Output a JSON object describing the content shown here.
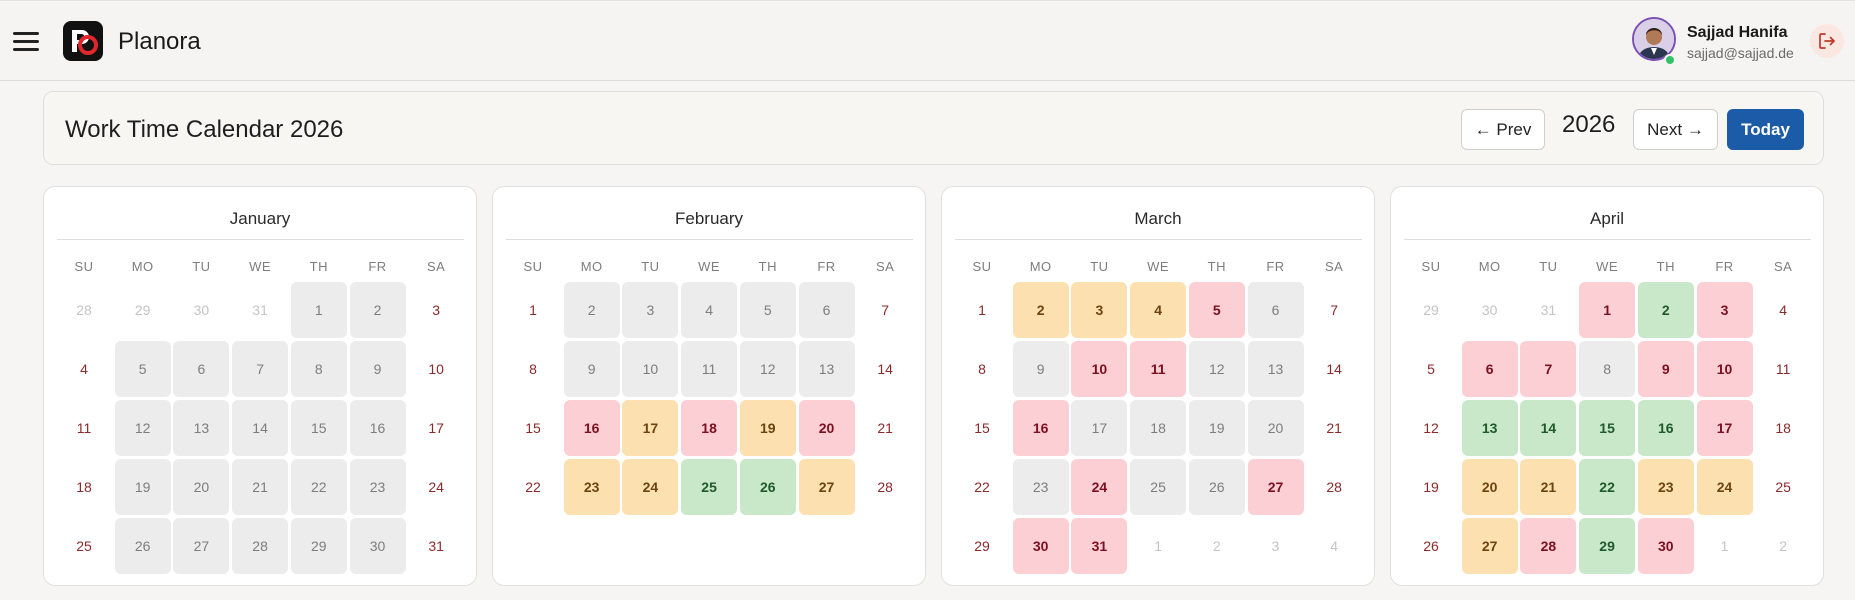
{
  "app": {
    "name": "Planora"
  },
  "user": {
    "name": "Sajjad Hanifa",
    "email": "sajjad@sajjad.de"
  },
  "icons": {
    "menu": "hamburger-icon",
    "logo": "planora-logo",
    "logout": "logout-icon",
    "avatar": "user-avatar"
  },
  "header": {
    "title": "Work Time Calendar 2026",
    "prev_label": "← Prev",
    "year": "2026",
    "next_label": "Next →",
    "today_label": "Today"
  },
  "colors": {
    "accent": "#1c5ba8",
    "gray_day": "#ececec",
    "pink_day": "#fccfd5",
    "orange_day": "#fde0b0",
    "green_day": "#c9e7c9",
    "weekend_text": "#8a2a2a",
    "online": "#34c06a"
  },
  "calendar": {
    "weekdays": [
      "SU",
      "MO",
      "TU",
      "WE",
      "TH",
      "FR",
      "SA"
    ],
    "months": [
      {
        "name": "January",
        "weeks": [
          [
            {
              "d": "28",
              "s": "out"
            },
            {
              "d": "29",
              "s": "out"
            },
            {
              "d": "30",
              "s": "out"
            },
            {
              "d": "31",
              "s": "out"
            },
            {
              "d": "1",
              "s": "gray"
            },
            {
              "d": "2",
              "s": "gray"
            },
            {
              "d": "3",
              "s": "we"
            }
          ],
          [
            {
              "d": "4",
              "s": "we"
            },
            {
              "d": "5",
              "s": "gray"
            },
            {
              "d": "6",
              "s": "gray"
            },
            {
              "d": "7",
              "s": "gray"
            },
            {
              "d": "8",
              "s": "gray"
            },
            {
              "d": "9",
              "s": "gray"
            },
            {
              "d": "10",
              "s": "we"
            }
          ],
          [
            {
              "d": "11",
              "s": "we"
            },
            {
              "d": "12",
              "s": "gray"
            },
            {
              "d": "13",
              "s": "gray"
            },
            {
              "d": "14",
              "s": "gray"
            },
            {
              "d": "15",
              "s": "gray"
            },
            {
              "d": "16",
              "s": "gray"
            },
            {
              "d": "17",
              "s": "we"
            }
          ],
          [
            {
              "d": "18",
              "s": "we"
            },
            {
              "d": "19",
              "s": "gray"
            },
            {
              "d": "20",
              "s": "gray"
            },
            {
              "d": "21",
              "s": "gray"
            },
            {
              "d": "22",
              "s": "gray"
            },
            {
              "d": "23",
              "s": "gray"
            },
            {
              "d": "24",
              "s": "we"
            }
          ],
          [
            {
              "d": "25",
              "s": "we"
            },
            {
              "d": "26",
              "s": "gray"
            },
            {
              "d": "27",
              "s": "gray"
            },
            {
              "d": "28",
              "s": "gray"
            },
            {
              "d": "29",
              "s": "gray"
            },
            {
              "d": "30",
              "s": "gray"
            },
            {
              "d": "31",
              "s": "we"
            }
          ]
        ]
      },
      {
        "name": "February",
        "weeks": [
          [
            {
              "d": "1",
              "s": "we"
            },
            {
              "d": "2",
              "s": "gray"
            },
            {
              "d": "3",
              "s": "gray"
            },
            {
              "d": "4",
              "s": "gray"
            },
            {
              "d": "5",
              "s": "gray"
            },
            {
              "d": "6",
              "s": "gray"
            },
            {
              "d": "7",
              "s": "we"
            }
          ],
          [
            {
              "d": "8",
              "s": "we"
            },
            {
              "d": "9",
              "s": "gray"
            },
            {
              "d": "10",
              "s": "gray"
            },
            {
              "d": "11",
              "s": "gray"
            },
            {
              "d": "12",
              "s": "gray"
            },
            {
              "d": "13",
              "s": "gray"
            },
            {
              "d": "14",
              "s": "we"
            }
          ],
          [
            {
              "d": "15",
              "s": "we"
            },
            {
              "d": "16",
              "s": "pink"
            },
            {
              "d": "17",
              "s": "orange"
            },
            {
              "d": "18",
              "s": "pink"
            },
            {
              "d": "19",
              "s": "orange"
            },
            {
              "d": "20",
              "s": "pink"
            },
            {
              "d": "21",
              "s": "we"
            }
          ],
          [
            {
              "d": "22",
              "s": "we"
            },
            {
              "d": "23",
              "s": "orange"
            },
            {
              "d": "24",
              "s": "orange"
            },
            {
              "d": "25",
              "s": "green"
            },
            {
              "d": "26",
              "s": "green"
            },
            {
              "d": "27",
              "s": "orange"
            },
            {
              "d": "28",
              "s": "we"
            }
          ]
        ]
      },
      {
        "name": "March",
        "weeks": [
          [
            {
              "d": "1",
              "s": "we"
            },
            {
              "d": "2",
              "s": "orange"
            },
            {
              "d": "3",
              "s": "orange"
            },
            {
              "d": "4",
              "s": "orange"
            },
            {
              "d": "5",
              "s": "pink"
            },
            {
              "d": "6",
              "s": "gray"
            },
            {
              "d": "7",
              "s": "we"
            }
          ],
          [
            {
              "d": "8",
              "s": "we"
            },
            {
              "d": "9",
              "s": "gray"
            },
            {
              "d": "10",
              "s": "pink"
            },
            {
              "d": "11",
              "s": "pink"
            },
            {
              "d": "12",
              "s": "gray"
            },
            {
              "d": "13",
              "s": "gray"
            },
            {
              "d": "14",
              "s": "we"
            }
          ],
          [
            {
              "d": "15",
              "s": "we"
            },
            {
              "d": "16",
              "s": "pink"
            },
            {
              "d": "17",
              "s": "gray"
            },
            {
              "d": "18",
              "s": "gray"
            },
            {
              "d": "19",
              "s": "gray"
            },
            {
              "d": "20",
              "s": "gray"
            },
            {
              "d": "21",
              "s": "we"
            }
          ],
          [
            {
              "d": "22",
              "s": "we"
            },
            {
              "d": "23",
              "s": "gray"
            },
            {
              "d": "24",
              "s": "pink"
            },
            {
              "d": "25",
              "s": "gray"
            },
            {
              "d": "26",
              "s": "gray"
            },
            {
              "d": "27",
              "s": "pink"
            },
            {
              "d": "28",
              "s": "we"
            }
          ],
          [
            {
              "d": "29",
              "s": "we"
            },
            {
              "d": "30",
              "s": "pink"
            },
            {
              "d": "31",
              "s": "pink"
            },
            {
              "d": "1",
              "s": "out"
            },
            {
              "d": "2",
              "s": "out"
            },
            {
              "d": "3",
              "s": "out"
            },
            {
              "d": "4",
              "s": "out"
            }
          ]
        ]
      },
      {
        "name": "April",
        "weeks": [
          [
            {
              "d": "29",
              "s": "out"
            },
            {
              "d": "30",
              "s": "out"
            },
            {
              "d": "31",
              "s": "out"
            },
            {
              "d": "1",
              "s": "pink"
            },
            {
              "d": "2",
              "s": "green"
            },
            {
              "d": "3",
              "s": "pink"
            },
            {
              "d": "4",
              "s": "we"
            }
          ],
          [
            {
              "d": "5",
              "s": "we"
            },
            {
              "d": "6",
              "s": "pink"
            },
            {
              "d": "7",
              "s": "pink"
            },
            {
              "d": "8",
              "s": "gray"
            },
            {
              "d": "9",
              "s": "pink"
            },
            {
              "d": "10",
              "s": "pink"
            },
            {
              "d": "11",
              "s": "we"
            }
          ],
          [
            {
              "d": "12",
              "s": "we"
            },
            {
              "d": "13",
              "s": "green"
            },
            {
              "d": "14",
              "s": "green"
            },
            {
              "d": "15",
              "s": "green"
            },
            {
              "d": "16",
              "s": "green"
            },
            {
              "d": "17",
              "s": "pink"
            },
            {
              "d": "18",
              "s": "we"
            }
          ],
          [
            {
              "d": "19",
              "s": "we"
            },
            {
              "d": "20",
              "s": "orange"
            },
            {
              "d": "21",
              "s": "orange"
            },
            {
              "d": "22",
              "s": "green"
            },
            {
              "d": "23",
              "s": "orange"
            },
            {
              "d": "24",
              "s": "orange"
            },
            {
              "d": "25",
              "s": "we"
            }
          ],
          [
            {
              "d": "26",
              "s": "we"
            },
            {
              "d": "27",
              "s": "orange"
            },
            {
              "d": "28",
              "s": "pink"
            },
            {
              "d": "29",
              "s": "green"
            },
            {
              "d": "30",
              "s": "pink"
            },
            {
              "d": "1",
              "s": "out"
            },
            {
              "d": "2",
              "s": "out"
            }
          ]
        ]
      }
    ]
  }
}
